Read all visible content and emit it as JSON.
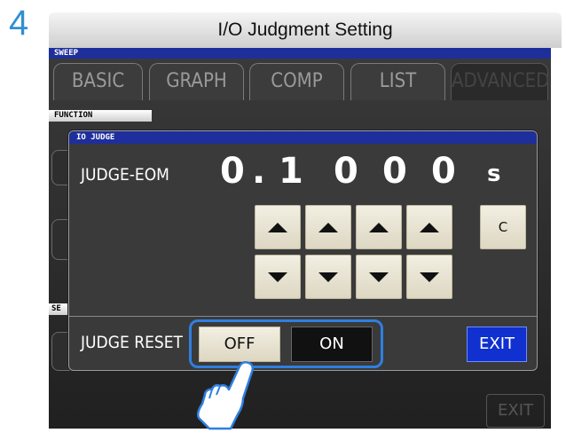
{
  "step_number": "4",
  "page_title": "I/O Judgment Setting",
  "screen": {
    "sweep_label": "SWEEP",
    "tabs": [
      {
        "label": "BASIC",
        "active": false
      },
      {
        "label": "GRAPH",
        "active": false
      },
      {
        "label": "COMP",
        "active": false
      },
      {
        "label": "LIST",
        "active": false
      },
      {
        "label": "ADVANCED",
        "active": true
      }
    ],
    "function_label": "FUNCTION",
    "side_label": "SE",
    "background_exit_label": "EXIT"
  },
  "dialog": {
    "title": "IO JUDGE",
    "judge_eom_label": "JUDGE-EOM",
    "value_digits": [
      "0",
      ".",
      "1",
      "0",
      "0",
      "0"
    ],
    "unit": "s",
    "clear_label": "C",
    "judge_reset_label": "JUDGE RESET",
    "off_label": "OFF",
    "on_label": "ON",
    "exit_label": "EXIT",
    "judge_reset_selected": "ON"
  },
  "colors": {
    "accent_blue": "#2f7fe0",
    "header_blue": "#1e2f9c",
    "exit_blue": "#1030d0",
    "button_cream": "#ece7d4"
  }
}
